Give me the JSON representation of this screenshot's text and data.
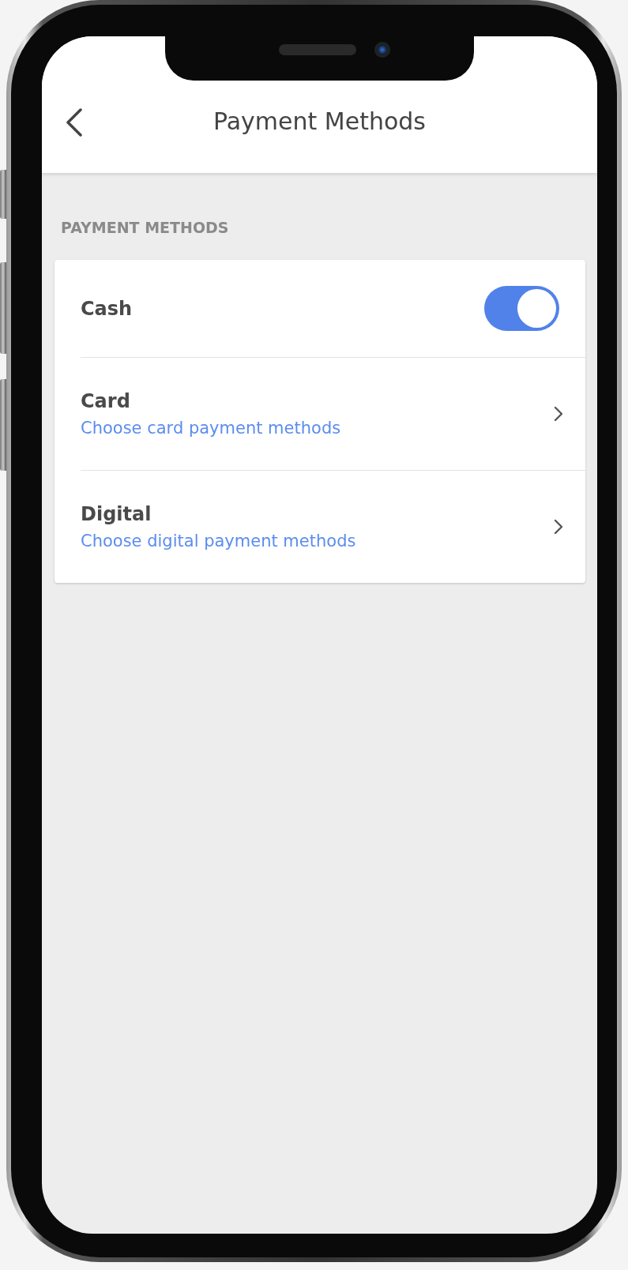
{
  "header": {
    "title": "Payment Methods"
  },
  "section": {
    "label": "PAYMENT METHODS"
  },
  "methods": [
    {
      "kind": "toggle",
      "title": "Cash",
      "on": true
    },
    {
      "kind": "link",
      "title": "Card",
      "subtitle": "Choose card payment methods"
    },
    {
      "kind": "link",
      "title": "Digital",
      "subtitle": "Choose digital payment methods"
    }
  ]
}
